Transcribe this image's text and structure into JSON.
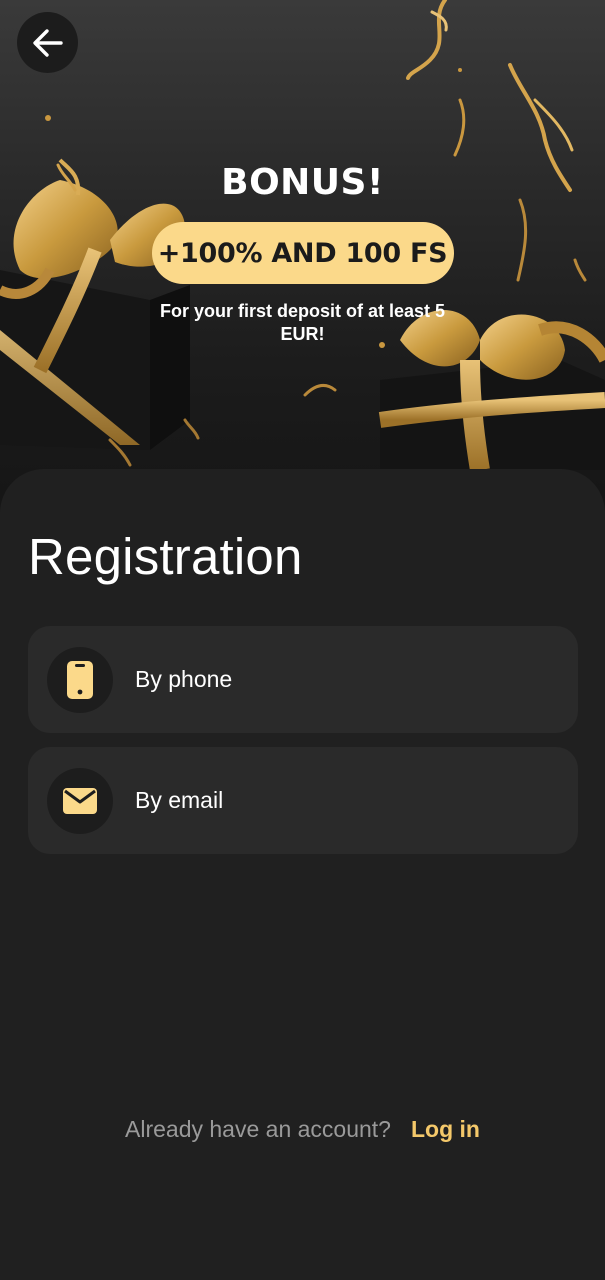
{
  "hero": {
    "title": "BONUS!",
    "offer": "+100% AND 100 FS",
    "description": "For your first deposit of at least 5 EUR!"
  },
  "registration": {
    "title": "Registration",
    "options": [
      {
        "label": "By phone",
        "icon": "phone-icon"
      },
      {
        "label": "By email",
        "icon": "mail-icon"
      }
    ]
  },
  "footer": {
    "prompt": "Already have an account?",
    "login_label": "Log in"
  },
  "colors": {
    "background": "#202020",
    "card": "#2a2a2a",
    "accent": "#fbd98a",
    "link": "#f4c86a",
    "muted_text": "#9a9a9a"
  }
}
